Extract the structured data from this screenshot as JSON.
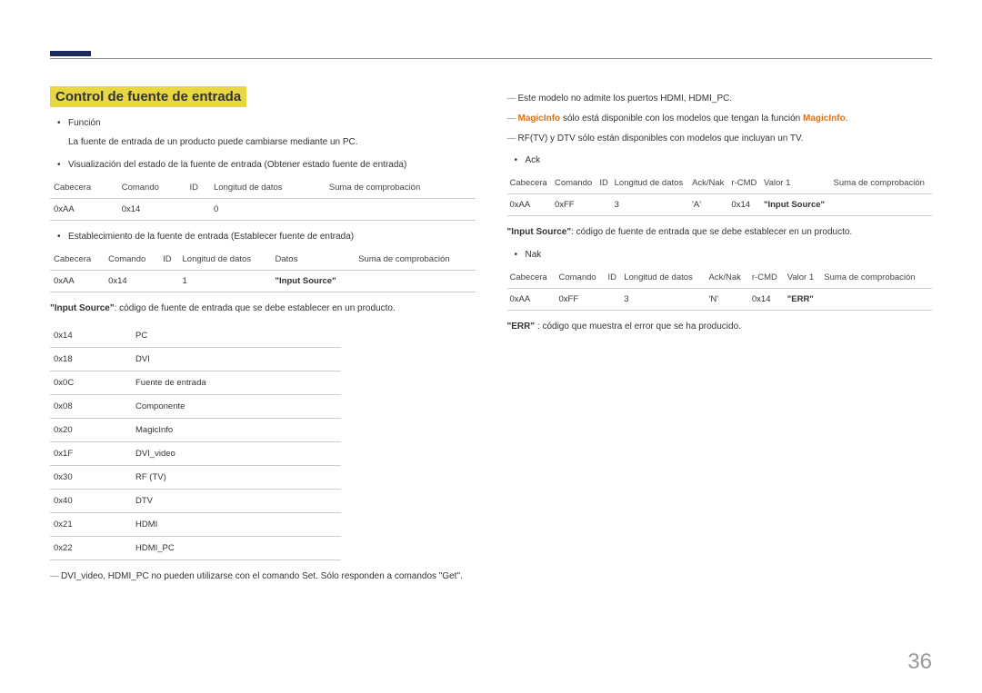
{
  "section_title": "Control de fuente de entrada",
  "left": {
    "b1": "Función",
    "b1_desc": "La fuente de entrada de un producto puede cambiarse mediante un PC.",
    "b2": "Visualización del estado de la fuente de entrada (Obtener estado fuente de entrada)",
    "t1_h": {
      "c0": "Cabecera",
      "c1": "Comando",
      "c2": "ID",
      "c3": "Longitud de datos",
      "c4": "Suma de comprobación"
    },
    "t1_r": {
      "c0": "0xAA",
      "c1": "0x14",
      "c2": "",
      "c3": "0",
      "c4": ""
    },
    "b3": "Establecimiento de la fuente de entrada (Establecer fuente de entrada)",
    "t2_h": {
      "c0": "Cabecera",
      "c1": "Comando",
      "c2": "ID",
      "c3": "Longitud de datos",
      "c4": "Datos",
      "c5": "Suma de comprobación"
    },
    "t2_r": {
      "c0": "0xAA",
      "c1": "0x14",
      "c2": "",
      "c3": "1",
      "c4": "\"Input Source\"",
      "c5": ""
    },
    "desc1_bold": "\"Input Source\"",
    "desc1_rest": ": código de fuente de entrada que se debe establecer en un producto.",
    "sources": [
      {
        "code": "0x14",
        "name": "PC"
      },
      {
        "code": "0x18",
        "name": "DVI"
      },
      {
        "code": "0x0C",
        "name": "Fuente de entrada"
      },
      {
        "code": "0x08",
        "name": "Componente"
      },
      {
        "code": "0x20",
        "name": "MagicInfo"
      },
      {
        "code": "0x1F",
        "name": "DVI_video"
      },
      {
        "code": "0x30",
        "name": "RF (TV)"
      },
      {
        "code": "0x40",
        "name": "DTV"
      },
      {
        "code": "0x21",
        "name": "HDMI"
      },
      {
        "code": "0x22",
        "name": "HDMI_PC"
      }
    ],
    "note1": "DVI_video, HDMI_PC no pueden utilizarse con el comando Set. Sólo responden a comandos \"Get\"."
  },
  "right": {
    "note2": "Este modelo no admite los puertos HDMI, HDMI_PC.",
    "note3_a": "MagicInfo",
    "note3_b": " sólo está disponible con los modelos que tengan la función ",
    "note3_c": "MagicInfo",
    "note3_d": ".",
    "note4": "RF(TV) y DTV sólo están disponibles con modelos que incluyan un TV.",
    "b_ack": "Ack",
    "ack_h": {
      "c0": "Cabecera",
      "c1": "Comando",
      "c2": "ID",
      "c3": "Longitud de datos",
      "c4": "Ack/Nak",
      "c5": "r-CMD",
      "c6": "Valor 1",
      "c7": "Suma de comprobación"
    },
    "ack_r": {
      "c0": "0xAA",
      "c1": "0xFF",
      "c2": "",
      "c3": "3",
      "c4": "'A'",
      "c5": "0x14",
      "c6": "\"Input Source\"",
      "c7": ""
    },
    "desc2_bold": "\"Input Source\"",
    "desc2_rest": ": código de fuente de entrada que se debe establecer en un producto.",
    "b_nak": "Nak",
    "nak_h": {
      "c0": "Cabecera",
      "c1": "Comando",
      "c2": "ID",
      "c3": "Longitud de datos",
      "c4": "Ack/Nak",
      "c5": "r-CMD",
      "c6": "Valor 1",
      "c7": "Suma de comprobación"
    },
    "nak_r": {
      "c0": "0xAA",
      "c1": "0xFF",
      "c2": "",
      "c3": "3",
      "c4": "'N'",
      "c5": "0x14",
      "c6": "\"ERR\"",
      "c7": ""
    },
    "desc3_bold": "\"ERR\"",
    "desc3_rest": " : código que muestra el error que se ha producido."
  },
  "page_num": "36"
}
